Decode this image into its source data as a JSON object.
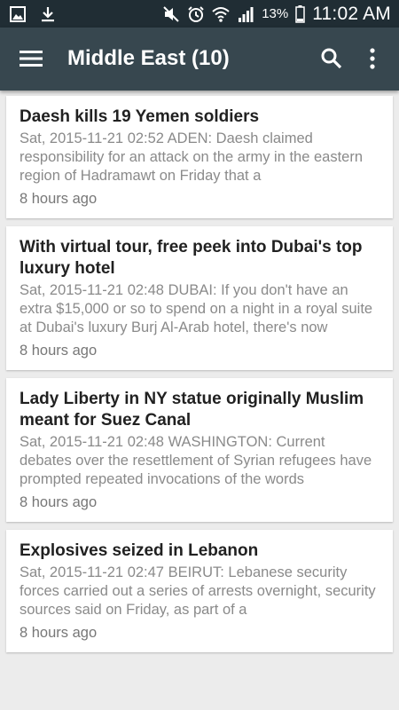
{
  "status_bar": {
    "left_icons": [
      "image-icon",
      "download-icon"
    ],
    "right_icons": [
      "mute-icon",
      "alarm-icon",
      "wifi-icon",
      "signal-icon",
      "battery-icon"
    ],
    "battery_percent": "13%",
    "time": "11:02 AM"
  },
  "app_bar": {
    "title": "Middle East (10)",
    "background": "#37474f"
  },
  "articles": [
    {
      "title": "Daesh kills 19 Yemen soldiers",
      "snippet": "Sat, 2015-11-21 02:52 ADEN: Daesh claimed responsibility for an attack on the army in the eastern region of Hadramawt on Friday that a",
      "age": "8 hours ago"
    },
    {
      "title": "With virtual tour, free peek into Dubai's top luxury hotel",
      "snippet": "Sat, 2015-11-21 02:48 DUBAI: If you don't have an extra $15,000 or so to spend on a night in a royal suite at Dubai's luxury Burj Al-Arab hotel, there's now",
      "age": "8 hours ago"
    },
    {
      "title": "Lady Liberty in NY statue originally Muslim meant for Suez Canal",
      "snippet": "Sat, 2015-11-21 02:48 WASHINGTON: Current debates over the resettlement of Syrian refugees have prompted repeated invocations of the words",
      "age": "8 hours ago"
    },
    {
      "title": "Explosives seized in Lebanon",
      "snippet": "Sat, 2015-11-21 02:47 BEIRUT: Lebanese security forces carried out a series of arrests overnight, security sources said on Friday, as part of a",
      "age": "8 hours ago"
    }
  ]
}
